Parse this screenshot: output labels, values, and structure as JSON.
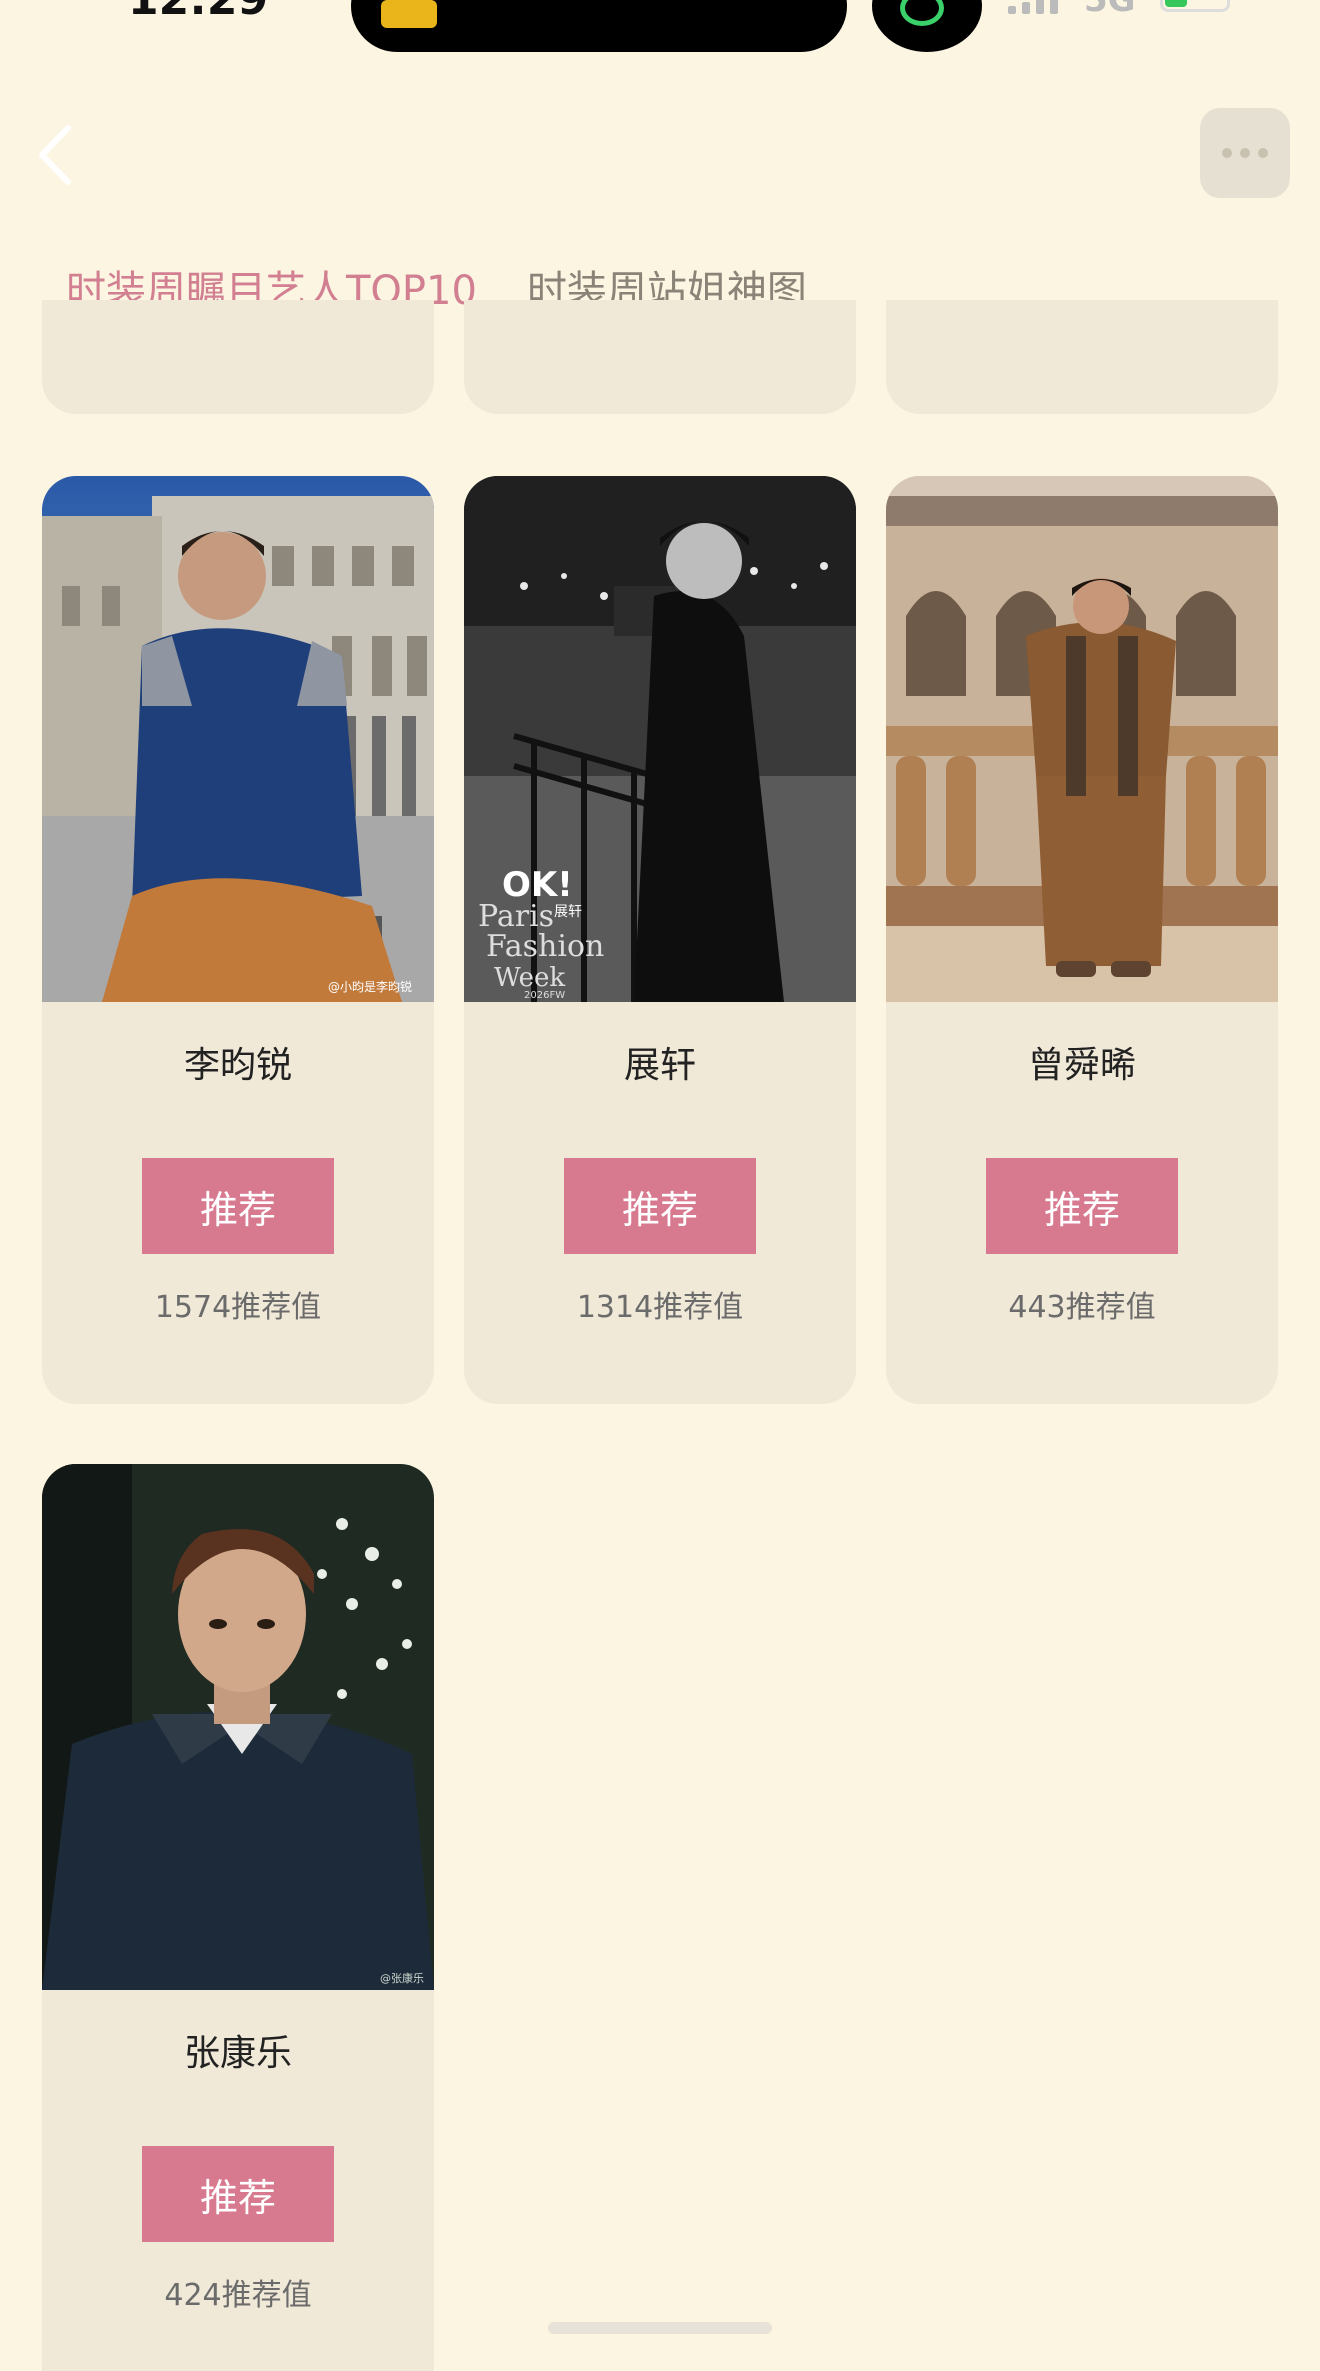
{
  "status_bar": {
    "time": "12:29",
    "network": "5G"
  },
  "nav": {
    "back_icon": "chevron-left-icon",
    "more_icon": "ellipsis-icon"
  },
  "tabs": [
    {
      "label": "时装周瞩目艺人TOP10",
      "active": true
    },
    {
      "label": "时装周站姐神图",
      "active": false
    }
  ],
  "artists": [
    {
      "name": "李昀锐",
      "button_label": "推荐",
      "score": "1574推荐值",
      "photo_caption": "@小昀是李昀锐"
    },
    {
      "name": "展轩",
      "button_label": "推荐",
      "score": "1314推荐值",
      "photo_caption": "OK! Paris 展轩 Fashion Week 2026FW"
    },
    {
      "name": "曾舜晞",
      "button_label": "推荐",
      "score": "443推荐值",
      "photo_caption": ""
    },
    {
      "name": "张康乐",
      "button_label": "推荐",
      "score": "424推荐值",
      "photo_caption": "@张康乐"
    }
  ],
  "colors": {
    "background": "#fcf5e2",
    "card": "#f1e9d8",
    "accent": "#d87a8f",
    "tab_active": "#d27f91"
  }
}
